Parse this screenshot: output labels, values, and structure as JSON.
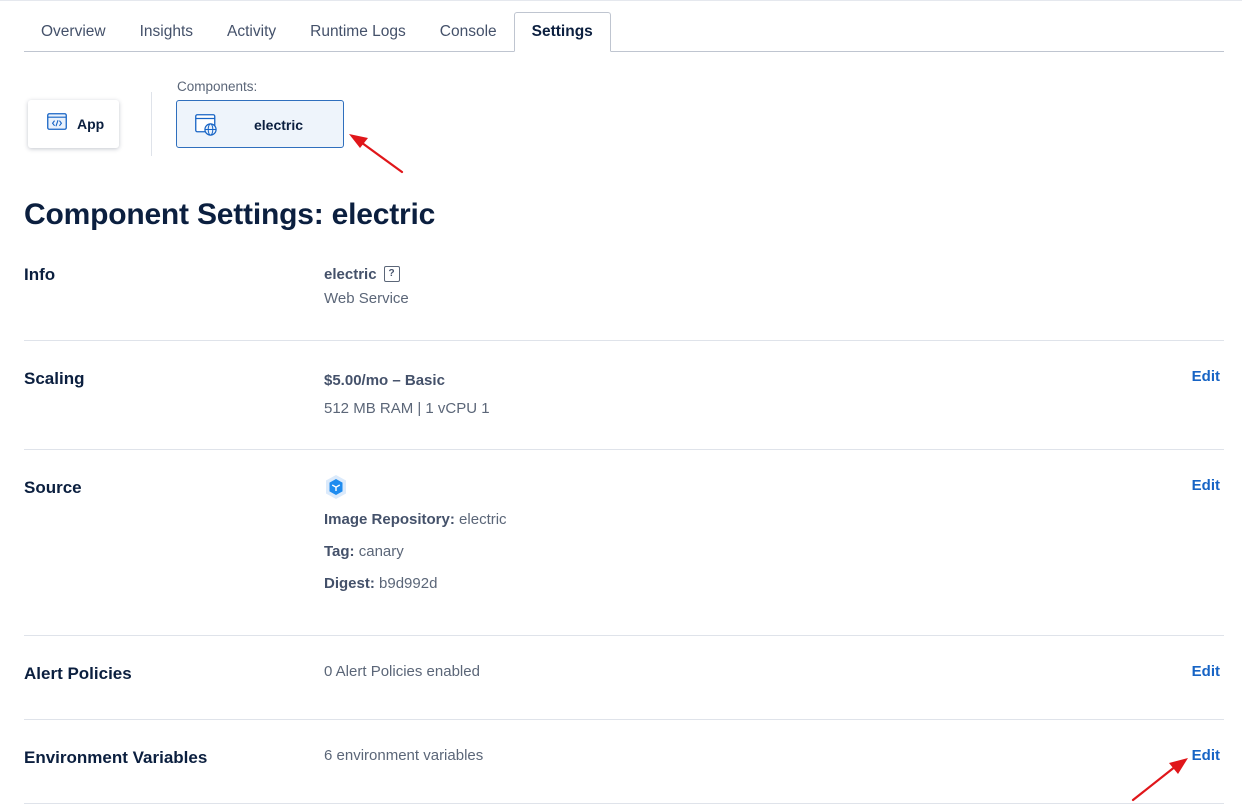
{
  "tabs": [
    {
      "label": "Overview",
      "active": false
    },
    {
      "label": "Insights",
      "active": false
    },
    {
      "label": "Activity",
      "active": false
    },
    {
      "label": "Runtime Logs",
      "active": false
    },
    {
      "label": "Console",
      "active": false
    },
    {
      "label": "Settings",
      "active": true
    }
  ],
  "app_card": {
    "label": "App",
    "icon": "code-window-icon"
  },
  "components": {
    "label": "Components:",
    "selected": {
      "label": "electric",
      "icon": "web-service-globe-icon"
    }
  },
  "page_title": "Component Settings: electric",
  "sections": {
    "info": {
      "title": "Info",
      "name": "electric",
      "help_icon_text": "?",
      "type": "Web Service"
    },
    "scaling": {
      "title": "Scaling",
      "plan": "$5.00/mo – Basic",
      "specs": "512 MB RAM | 1 vCPU 1",
      "edit": "Edit"
    },
    "source": {
      "title": "Source",
      "icon": "container-registry-icon",
      "repo_label": "Image Repository:",
      "repo_value": "electric",
      "tag_label": "Tag:",
      "tag_value": "canary",
      "digest_label": "Digest:",
      "digest_value": "b9d992d",
      "edit": "Edit"
    },
    "alerts": {
      "title": "Alert Policies",
      "summary": "0 Alert Policies enabled",
      "edit": "Edit"
    },
    "env": {
      "title": "Environment Variables",
      "summary": "6 environment variables",
      "edit": "Edit"
    }
  },
  "colors": {
    "accent": "#1764c5",
    "heading": "#0b1f3f",
    "annotation_arrow": "#e0161a"
  }
}
